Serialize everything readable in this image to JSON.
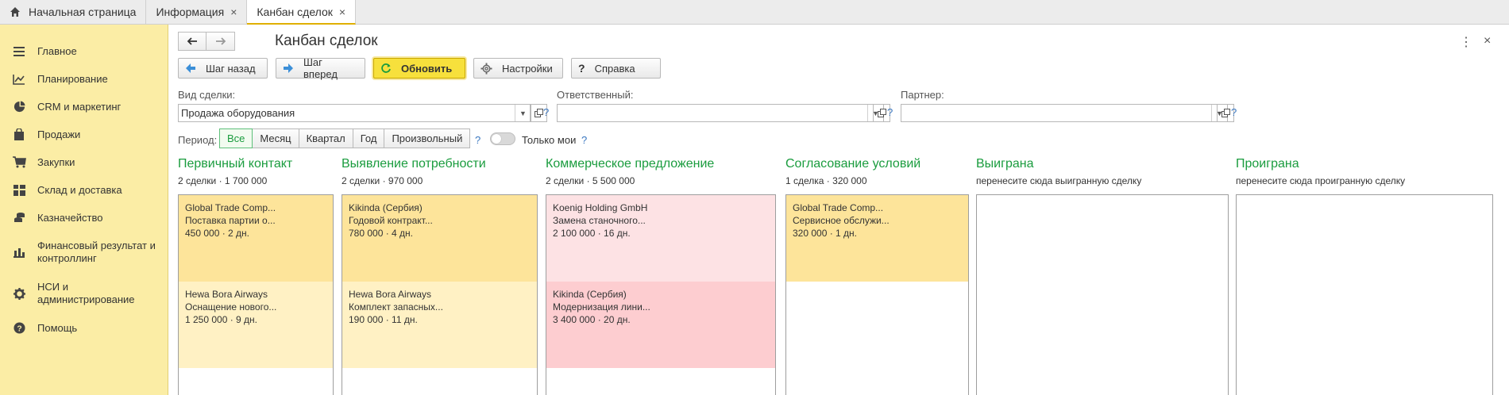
{
  "tabs": [
    {
      "label": "Начальная страница"
    },
    {
      "label": "Информация",
      "close": "×"
    },
    {
      "label": "Канбан сделок",
      "close": "×"
    }
  ],
  "sidebar": {
    "items": [
      {
        "label": "Главное",
        "icon": "menu-icon"
      },
      {
        "label": "Планирование",
        "icon": "chart-line-icon"
      },
      {
        "label": "CRM и маркетинг",
        "icon": "pie-chart-icon"
      },
      {
        "label": "Продажи",
        "icon": "bag-icon"
      },
      {
        "label": "Закупки",
        "icon": "cart-icon"
      },
      {
        "label": "Склад и доставка",
        "icon": "grid-icon"
      },
      {
        "label": "Казначейство",
        "icon": "coins-icon"
      },
      {
        "label": "Финансовый результат и контроллинг",
        "icon": "bar-chart-icon"
      },
      {
        "label": "НСИ и администрирование",
        "icon": "gear-icon"
      },
      {
        "label": "Помощь",
        "icon": "help-icon"
      }
    ]
  },
  "header": {
    "title": "Канбан сделок",
    "more": "⋮",
    "close": "×"
  },
  "toolbar": {
    "back": "Шаг назад",
    "forward": "Шаг вперед",
    "refresh": "Обновить",
    "settings": "Настройки",
    "help": "Справка",
    "help_glyph": "?"
  },
  "filters": {
    "deal_type_label": "Вид сделки:",
    "deal_type_value": "Продажа оборудования",
    "responsible_label": "Ответственный:",
    "responsible_value": "",
    "partner_label": "Партнер:",
    "partner_value": "",
    "q": "?"
  },
  "period": {
    "label": "Период:",
    "options": [
      "Все",
      "Месяц",
      "Квартал",
      "Год",
      "Произвольный"
    ],
    "selected": "Все",
    "only_mine": "Только мои",
    "only_mine_on": false
  },
  "columns": [
    {
      "title": "Первичный контакт",
      "summary": "2 сделки · 1 700 000",
      "cards": [
        {
          "company": "Global Trade Comp...",
          "desc": "Поставка партии о...",
          "meta": "450 000 · 2 дн."
        },
        {
          "company": "Hewa Bora Airways",
          "desc": "Оснащение нового...",
          "meta": "1 250 000 · 9 дн."
        }
      ]
    },
    {
      "title": "Выявление потребности",
      "summary": "2 сделки · 970 000",
      "cards": [
        {
          "company": "Kikinda (Сербия)",
          "desc": "Годовой контракт...",
          "meta": "780 000 · 4 дн."
        },
        {
          "company": "Hewa Bora Airways",
          "desc": "Комплект запасных...",
          "meta": "190 000 · 11 дн."
        }
      ]
    },
    {
      "title": "Коммерческое предложение",
      "summary": "2 сделки · 5 500 000",
      "cards": [
        {
          "company": "Koenig Holding GmbH",
          "desc": "Замена станочного...",
          "meta": "2 100 000 · 16 дн."
        },
        {
          "company": "Kikinda (Сербия)",
          "desc": "Модернизация лини...",
          "meta": "3 400 000 · 20 дн."
        }
      ]
    },
    {
      "title": "Согласование условий",
      "summary": "1 сделка · 320 000",
      "cards": [
        {
          "company": "Global Trade Comp...",
          "desc": "Сервисное обслужи...",
          "meta": "320 000 · 1 дн."
        }
      ]
    },
    {
      "title": "Выиграна",
      "summary": "перенесите сюда выигранную сделку",
      "cards": []
    },
    {
      "title": "Проиграна",
      "summary": "перенесите сюда проигранную сделку",
      "cards": []
    }
  ],
  "colors": {
    "accent_green": "#1a9c3e",
    "sidebar_bg": "#fbeda5",
    "primary_button": "#f7e03c"
  }
}
